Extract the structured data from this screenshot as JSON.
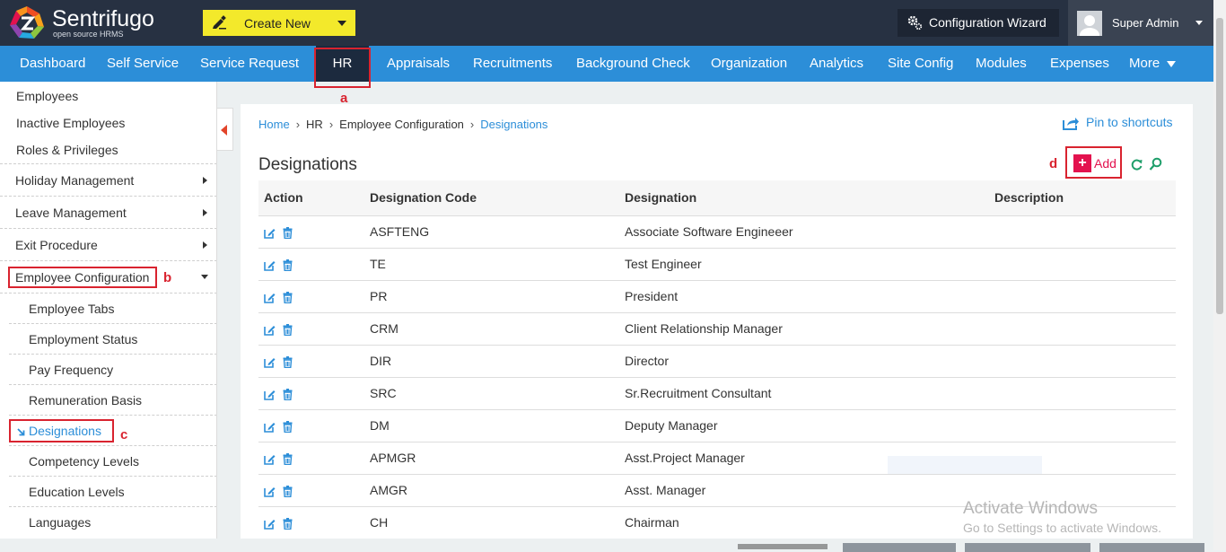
{
  "brand": {
    "name": "Sentrifugo",
    "tagline": "open source HRMS"
  },
  "header": {
    "create_new": "Create New",
    "config_wizard": "Configuration Wizard",
    "user_name": "Super Admin"
  },
  "nav": {
    "items": [
      "Dashboard",
      "Self Service",
      "Service Request",
      "HR",
      "Appraisals",
      "Recruitments",
      "Background Check",
      "Organization",
      "Analytics",
      "Site Config",
      "Modules",
      "Expenses"
    ],
    "more": "More",
    "active": "HR"
  },
  "sidebar": {
    "top_items": [
      "Employees",
      "Inactive Employees",
      "Roles & Privileges"
    ],
    "sections": [
      "Holiday Management",
      "Leave Management",
      "Exit Procedure",
      "Employee Configuration"
    ],
    "sub_items": [
      "Employee Tabs",
      "Employment Status",
      "Pay Frequency",
      "Remuneration Basis",
      "Designations",
      "Competency Levels",
      "Education Levels",
      "Languages"
    ],
    "active": "Designations"
  },
  "breadcrumb": [
    "Home",
    "HR",
    "Employee Configuration",
    "Designations"
  ],
  "pin_label": "Pin to shortcuts",
  "page_title": "Designations",
  "add_label": "Add",
  "table": {
    "columns": [
      "Action",
      "Designation Code",
      "Designation",
      "Description"
    ],
    "rows": [
      {
        "code": "ASFTENG",
        "designation": "Associate Software Engineeer",
        "description": ""
      },
      {
        "code": "TE",
        "designation": "Test Engineer",
        "description": ""
      },
      {
        "code": "PR",
        "designation": "President",
        "description": ""
      },
      {
        "code": "CRM",
        "designation": "Client Relationship Manager",
        "description": ""
      },
      {
        "code": "DIR",
        "designation": "Director",
        "description": ""
      },
      {
        "code": "SRC",
        "designation": "Sr.Recruitment Consultant",
        "description": ""
      },
      {
        "code": "DM",
        "designation": "Deputy Manager",
        "description": ""
      },
      {
        "code": "APMGR",
        "designation": "Asst.Project Manager",
        "description": ""
      },
      {
        "code": "AMGR",
        "designation": "Asst. Manager",
        "description": ""
      },
      {
        "code": "CH",
        "designation": "Chairman",
        "description": ""
      }
    ]
  },
  "annotations": [
    "a",
    "b",
    "c",
    "d"
  ],
  "watermark": {
    "line1": "Activate Windows",
    "line2": "Go to Settings to activate Windows."
  },
  "colors": {
    "nav": "#2c8ed8",
    "topbar": "#273142",
    "accent_add": "#e3124e",
    "annotation": "#d9232f",
    "create_button": "#f3e92b"
  }
}
